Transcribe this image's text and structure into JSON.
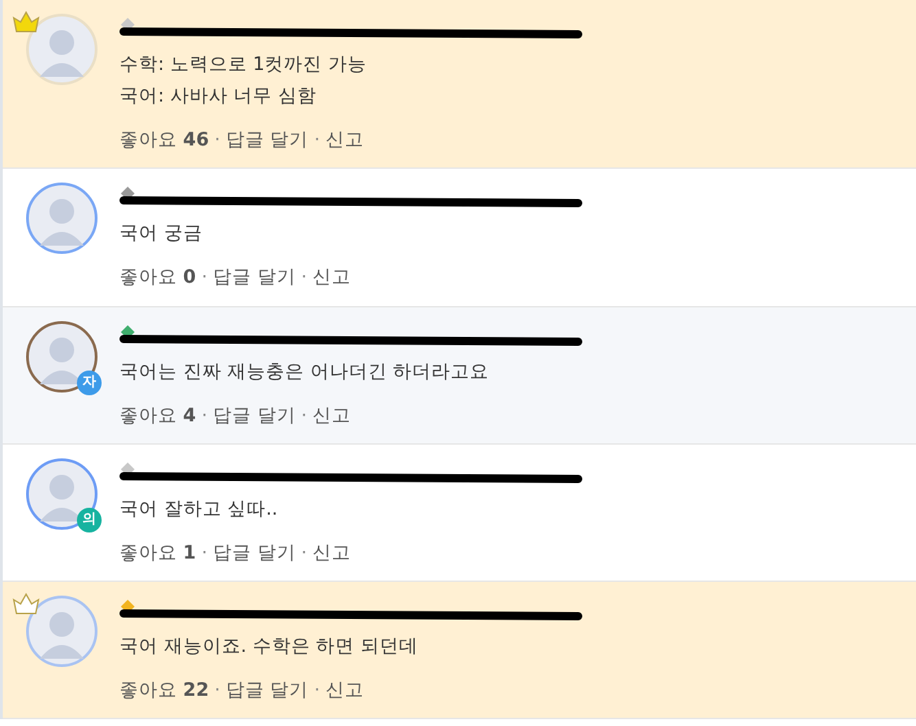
{
  "comments": [
    {
      "kind": "highlight",
      "crown": {
        "color": "#f2d80c"
      },
      "avatar": {
        "color": "#eadfc6"
      },
      "rank": {
        "color": "#c8c8c8"
      },
      "body": [
        "수학: 노력으로 1컷까진 가능",
        "국어: 사바사 너무 심함"
      ],
      "like_label": "좋아요",
      "likes": "46",
      "separator_1": "·",
      "reply": "답글 달기",
      "separator_2": "·",
      "report": "신고"
    },
    {
      "kind": "plain",
      "avatar": {
        "color": "#7aa7f5"
      },
      "rank": {
        "color": "#9a9a9a"
      },
      "body": [
        "국어 궁금"
      ],
      "like_label": "좋아요",
      "likes": "0",
      "separator_1": "·",
      "reply": "답글 달기",
      "separator_2": "·",
      "report": "신고"
    },
    {
      "kind": "muted",
      "avatar": {
        "color": "#8a6a4e"
      },
      "rank": {
        "color": "#3fae6e"
      },
      "badge": {
        "text": "자",
        "color": "#3d9be9"
      },
      "body": [
        "국어는 진짜 재능충은 어나더긴 하더라고요"
      ],
      "like_label": "좋아요",
      "likes": "4",
      "separator_1": "·",
      "reply": "답글 달기",
      "separator_2": "·",
      "report": "신고"
    },
    {
      "kind": "plain",
      "avatar": {
        "color": "#6d9cf5"
      },
      "rank": {
        "color": "#c8c8c8"
      },
      "badge": {
        "text": "의",
        "color": "#17b3a0"
      },
      "body": [
        "국어 잘하고 싶따.."
      ],
      "like_label": "좋아요",
      "likes": "1",
      "separator_1": "·",
      "reply": "답글 달기",
      "separator_2": "·",
      "report": "신고"
    },
    {
      "kind": "highlight",
      "crown": {
        "color": "#ffffff"
      },
      "avatar": {
        "color": "#a9c3f2"
      },
      "rank": {
        "color": "#f2b420"
      },
      "body": [
        "국어 재능이죠. 수학은 하면 되던데"
      ],
      "like_label": "좋아요",
      "likes": "22",
      "separator_1": "·",
      "reply": "답글 달기",
      "separator_2": "·",
      "report": "신고"
    }
  ]
}
